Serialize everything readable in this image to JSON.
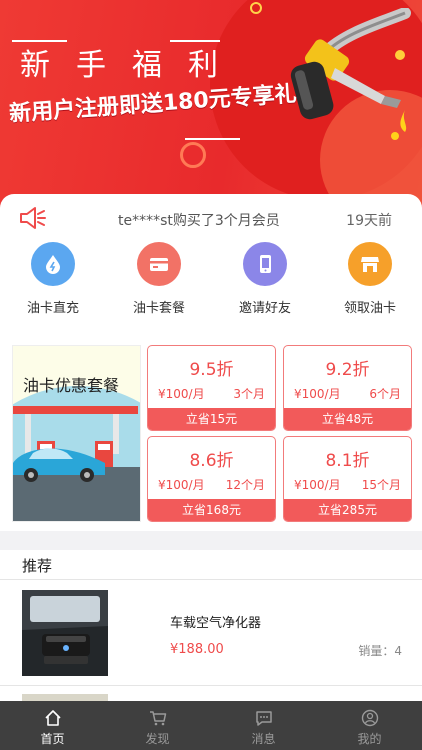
{
  "banner": {
    "title": "新手福利",
    "subtitle": "新用户注册即送180元专享礼包",
    "icon": "fuel-nozzle-icon"
  },
  "notice": {
    "icon": "speaker-icon",
    "text": "te****st购买了3个月会员",
    "time": "19天前"
  },
  "nav": [
    {
      "label": "油卡直充",
      "icon": "drop-icon",
      "color": "#5ba7f0"
    },
    {
      "label": "油卡套餐",
      "icon": "card-icon",
      "color": "#f27266"
    },
    {
      "label": "邀请好友",
      "icon": "phone-icon",
      "color": "#8b86e8"
    },
    {
      "label": "领取油卡",
      "icon": "shop-icon",
      "color": "#f6a02a"
    }
  ],
  "packages": {
    "title": "油卡优惠套餐",
    "items": [
      {
        "discount": "9.5折",
        "price": "¥100/月",
        "months": "3个月",
        "save": "立省15元"
      },
      {
        "discount": "9.2折",
        "price": "¥100/月",
        "months": "6个月",
        "save": "立省48元"
      },
      {
        "discount": "8.6折",
        "price": "¥100/月",
        "months": "12个月",
        "save": "立省168元"
      },
      {
        "discount": "8.1折",
        "price": "¥100/月",
        "months": "15个月",
        "save": "立省285元"
      }
    ]
  },
  "recommend": {
    "title": "推荐",
    "products": [
      {
        "name": "车载空气净化器",
        "price": "¥188.00",
        "sales": "销量：4"
      }
    ]
  },
  "tabbar": [
    {
      "label": "首页",
      "icon": "home-icon",
      "active": true
    },
    {
      "label": "发现",
      "icon": "cart-icon",
      "active": false
    },
    {
      "label": "消息",
      "icon": "message-icon",
      "active": false
    },
    {
      "label": "我的",
      "icon": "user-icon",
      "active": false
    }
  ],
  "colors": {
    "accent": "#ef4b4b",
    "tabbar": "#3f3f3f"
  }
}
